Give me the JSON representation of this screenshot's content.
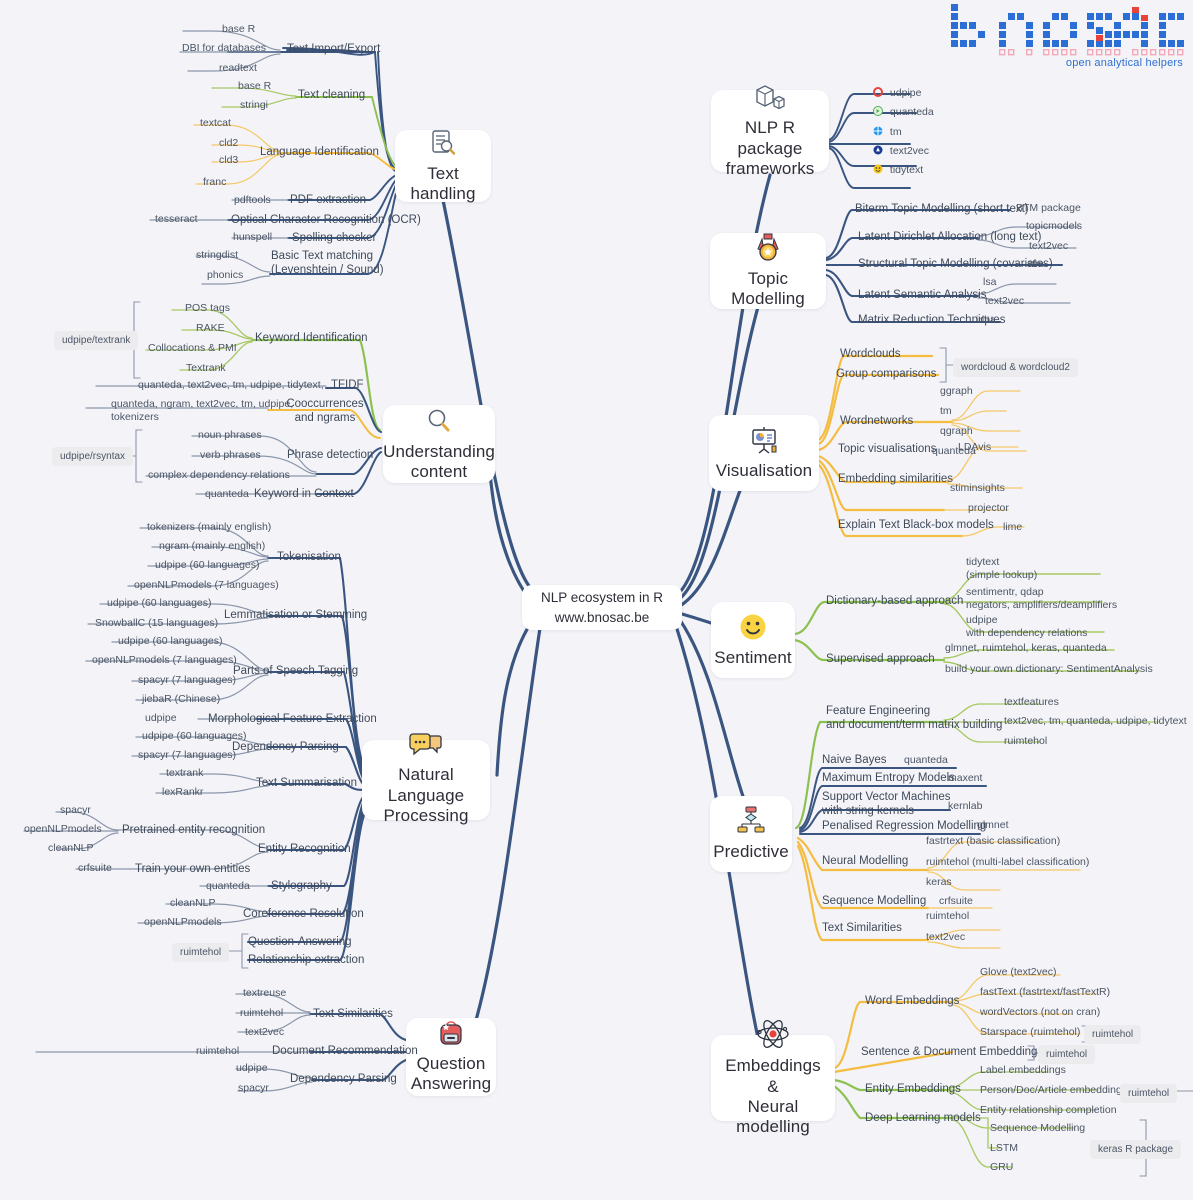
{
  "brand": {
    "name": "bnosac",
    "tagline": "open analytical helpers",
    "logo_colors": {
      "blue": "#2b6fd6",
      "pink": "#f3a8b8"
    }
  },
  "central": {
    "line1": "NLP ecosystem in R",
    "line2": "www.bnosac.be"
  },
  "palette": {
    "trunk": "#3a5580",
    "navy": "#3a5580",
    "green": "#8cc152",
    "yellow": "#f5bc42",
    "slate": "#8b96aa",
    "background": "#f4f4f8",
    "card": "#ffffff",
    "pill": "#ececef"
  },
  "branches": [
    {
      "id": "text-handling",
      "title": "Text handling",
      "icon": "document-magnifier-icon",
      "side": "left",
      "topics": [
        {
          "label": "Text Import/Export",
          "color": "navy",
          "leaves": [
            "base R",
            "DBI for databases",
            "readtext"
          ]
        },
        {
          "label": "Text cleaning",
          "color": "green",
          "leaves": [
            "base R",
            "stringi"
          ]
        },
        {
          "label": "Language Identification",
          "color": "yellow",
          "leaves": [
            "textcat",
            "cld2",
            "cld3",
            "franc"
          ]
        },
        {
          "label": "PDF extraction",
          "color": "navy",
          "leaves": [
            "pdftools"
          ]
        },
        {
          "label": "Optical Character Recognition (OCR)",
          "color": "navy",
          "leaves": [
            "tesseract"
          ]
        },
        {
          "label": "Spelling checker",
          "color": "navy",
          "leaves": [
            "hunspell"
          ]
        },
        {
          "label": "Basic Text matching (Levenshtein / Sound)",
          "color": "navy",
          "leaves": [
            "stringdist",
            "phonics"
          ]
        }
      ]
    },
    {
      "id": "understanding-content",
      "title": "Understanding content",
      "icon": "magnifying-glass-icon",
      "side": "left",
      "topics": [
        {
          "label": "Keyword Identification",
          "color": "green",
          "leaves": [
            "POS tags",
            "RAKE",
            "Collocations & PMI",
            "Textrank"
          ],
          "badge": "udpipe/textrank"
        },
        {
          "label": "TFIDF",
          "color": "navy",
          "leaves": [
            "quanteda, text2vec, tm, udpipe, tidytext, ..."
          ]
        },
        {
          "label": "Cooccurrences and ngrams",
          "color": "yellow",
          "leaves": [
            "quanteda, ngram, text2vec, tm, udpipe, tokenizers"
          ]
        },
        {
          "label": "Phrase detection",
          "color": "navy",
          "leaves": [
            "noun phrases",
            "verb phrases",
            "complex dependency relations"
          ],
          "badge": "udpipe/rsyntax"
        },
        {
          "label": "Keyword in Context",
          "color": "navy",
          "leaves": [
            "quanteda"
          ]
        }
      ]
    },
    {
      "id": "natural-language-processing",
      "title": "Natural Language Processing",
      "icon": "speech-bubbles-icon",
      "side": "left",
      "topics": [
        {
          "label": "Tokenisation",
          "color": "navy",
          "leaves": [
            "tokenizers (mainly english)",
            "ngram (mainly english)",
            "udpipe (60 languages)",
            "openNLPmodels (7 languages)"
          ]
        },
        {
          "label": "Lemmatisation or Stemming",
          "color": "navy",
          "leaves": [
            "udpipe (60 languages)",
            "SnowballC (15 languages)"
          ]
        },
        {
          "label": "Parts of Speech Tagging",
          "color": "navy",
          "leaves": [
            "udpipe (60 languages)",
            "openNLPmodels (7 languages)",
            "spacyr (7 languages)",
            "jiebaR (Chinese)"
          ]
        },
        {
          "label": "Morphological Feature Extraction",
          "color": "navy",
          "leaves": [
            "udpipe"
          ]
        },
        {
          "label": "Dependency Parsing",
          "color": "navy",
          "leaves": [
            "udpipe (60 languages)",
            "spacyr (7 languages)"
          ]
        },
        {
          "label": "Text Summarisation",
          "color": "navy",
          "leaves": [
            "textrank",
            "lexRankr"
          ]
        },
        {
          "label": "Entity Recognition",
          "color": "navy",
          "leaves": [
            "Pretrained entity recognition",
            "Train your own entities"
          ],
          "sub": [
            "spacyr",
            "openNLPmodels",
            "cleanNLP",
            "crfsuite"
          ]
        },
        {
          "label": "Stylography",
          "color": "navy",
          "leaves": [
            "quanteda"
          ]
        },
        {
          "label": "Coreference Resolution",
          "color": "navy",
          "leaves": [
            "cleanNLP",
            "openNLPmodels"
          ]
        },
        {
          "label": "Question-Answering",
          "color": "navy",
          "leaves": [],
          "badge": "ruimtehol"
        },
        {
          "label": "Relationship extraction",
          "color": "navy",
          "leaves": []
        }
      ]
    },
    {
      "id": "question-answering",
      "title": "Question Answering",
      "icon": "backpack-icon",
      "side": "left",
      "topics": [
        {
          "label": "Text Similarities",
          "color": "navy",
          "leaves": [
            "textreuse",
            "ruimtehol",
            "text2vec"
          ]
        },
        {
          "label": "Document Recommendation",
          "color": "navy",
          "leaves": [
            "ruimtehol"
          ]
        },
        {
          "label": "Dependency Parsing",
          "color": "navy",
          "leaves": [
            "udpipe",
            "spacyr"
          ]
        }
      ]
    },
    {
      "id": "nlp-r-package-frameworks",
      "title": "NLP R package frameworks",
      "icon": "boxes-icon",
      "side": "right",
      "topics": [
        {
          "label": "udpipe",
          "color": "navy",
          "icon": "package-icon-red",
          "icon_color": "#e8433a"
        },
        {
          "label": "quanteda",
          "color": "navy",
          "icon": "package-icon-green",
          "icon_color": "#4cae50"
        },
        {
          "label": "tm",
          "color": "navy",
          "icon": "package-icon-blue",
          "icon_color": "#2196f3"
        },
        {
          "label": "text2vec",
          "color": "navy",
          "icon": "package-icon-darkblue",
          "icon_color": "#1b3a93"
        },
        {
          "label": "tidytext",
          "color": "navy",
          "icon": "package-icon-yellow",
          "icon_color": "#f5c518"
        }
      ]
    },
    {
      "id": "topic-modelling",
      "title": "Topic Modelling",
      "icon": "medal-icon",
      "side": "right",
      "topics": [
        {
          "label": "Biterm Topic Modelling (short text)",
          "color": "navy",
          "leaves": [
            "BTM package"
          ]
        },
        {
          "label": "Latent Dirichlet Allocation (long text)",
          "color": "navy",
          "leaves": [
            "topicmodels",
            "text2vec"
          ]
        },
        {
          "label": "Structural Topic Modelling (covariates)",
          "color": "navy",
          "leaves": [
            "stm"
          ]
        },
        {
          "label": "Latent Semantic Analysis",
          "color": "navy",
          "leaves": [
            "lsa",
            "text2vec"
          ]
        },
        {
          "label": "Matrix Reduction Techniques",
          "color": "navy",
          "leaves": [
            "irlba"
          ]
        }
      ]
    },
    {
      "id": "visualisation",
      "title": "Visualisation",
      "icon": "presentation-chart-icon",
      "side": "right",
      "topics": [
        {
          "label": "Wordclouds",
          "color": "yellow",
          "leaves": [],
          "badge": "wordcloud & wordcloud2"
        },
        {
          "label": "Group comparisons",
          "color": "yellow",
          "leaves": []
        },
        {
          "label": "Wordnetworks",
          "color": "yellow",
          "leaves": [
            "ggraph",
            "tm",
            "qgraph",
            "quanteda"
          ]
        },
        {
          "label": "Topic visualisations",
          "color": "yellow",
          "leaves": [
            "LDAvis",
            "stiminsights"
          ]
        },
        {
          "label": "Embedding similarities",
          "color": "yellow",
          "leaves": [
            "projector"
          ]
        },
        {
          "label": "Explain Text Black-box models",
          "color": "yellow",
          "leaves": [
            "lime"
          ]
        }
      ]
    },
    {
      "id": "sentiment",
      "title": "Sentiment",
      "icon": "smiley-face-icon",
      "side": "right",
      "topics": [
        {
          "label": "Dictionary-based approach",
          "color": "green",
          "leaves": [
            "tidytext (simple lookup)",
            "sentimentr, qdap negators, amplifiers/deamplifiers",
            "udpipe with dependency relations"
          ]
        },
        {
          "label": "Supervised approach",
          "color": "green",
          "leaves": [
            "glmnet, ruimtehol, keras, quanteda",
            "build your own dictionary: SentimentAnalysis"
          ]
        }
      ]
    },
    {
      "id": "predictive",
      "title": "Predictive",
      "icon": "flowchart-icon",
      "side": "right",
      "topics": [
        {
          "label": "Feature Engineering and document/term matrix building",
          "color": "green",
          "leaves": [
            "textfeatures",
            "text2vec, tm, quanteda, udpipe, tidytext",
            "ruimtehol"
          ]
        },
        {
          "label": "Naive Bayes",
          "color": "navy",
          "leaves": [
            "quanteda"
          ]
        },
        {
          "label": "Maximum Entropy Models",
          "color": "navy",
          "leaves": [
            "maxent"
          ]
        },
        {
          "label": "Support Vector Machines with string kernels",
          "color": "navy",
          "leaves": [
            "kernlab"
          ]
        },
        {
          "label": "Penalised Regression Modelling",
          "color": "navy",
          "leaves": [
            "glmnet"
          ]
        },
        {
          "label": "Neural Modelling",
          "color": "yellow",
          "leaves": [
            "fastrtext (basic classification)",
            "ruimtehol (multi-label classification)",
            "keras"
          ]
        },
        {
          "label": "Sequence Modelling",
          "color": "yellow",
          "leaves": [
            "crfsuite"
          ]
        },
        {
          "label": "Text Similarities",
          "color": "yellow",
          "leaves": [
            "ruimtehol",
            "text2vec"
          ]
        }
      ]
    },
    {
      "id": "embeddings-neural-modelling",
      "title": "Embeddings & Neural modelling",
      "icon": "atom-icon",
      "side": "right",
      "topics": [
        {
          "label": "Word Embeddings",
          "color": "yellow",
          "leaves": [
            "Glove (text2vec)",
            "fastText (fastrtext/fastTextR)",
            "wordVectors (not on cran)",
            "Starspace (ruimtehol)"
          ],
          "badge": "ruimtehol"
        },
        {
          "label": "Sentence & Document Embeddings",
          "color": "yellow",
          "leaves": [],
          "badge": "ruimtehol"
        },
        {
          "label": "Entity Embeddings",
          "color": "green",
          "leaves": [
            "Label embeddings",
            "Person/Doc/Article embeddings",
            "Entity relationship completion"
          ],
          "badge": "ruimtehol"
        },
        {
          "label": "Deep Learning models",
          "color": "green",
          "leaves": [
            "Sequence Modelling",
            "LSTM",
            "GRU"
          ],
          "badge": "keras R package"
        }
      ]
    }
  ],
  "labels": {
    "text_handling": {
      "title": "Text handling",
      "t1": "Text Import/Export",
      "t1a": "base R",
      "t1b": "DBI for databases",
      "t1c": "readtext",
      "t2": "Text cleaning",
      "t2a": "base R",
      "t2b": "stringi",
      "t3": "Language Identification",
      "t3a": "textcat",
      "t3b": "cld2",
      "t3c": "cld3",
      "t3d": "franc",
      "t4": "PDF extraction",
      "t4a": "pdftools",
      "t5": "Optical Character Recognition (OCR)",
      "t5a": "tesseract",
      "t6": "Spelling checker",
      "t6a": "hunspell",
      "t7l1": "Basic Text matching",
      "t7l2": "(Levenshtein / Sound)",
      "t7a": "stringdist",
      "t7b": "phonics"
    },
    "understanding": {
      "title1": "Understanding",
      "title2": "content",
      "k": "Keyword Identification",
      "k1": "POS tags",
      "k2": "RAKE",
      "k3": "Collocations & PMI",
      "k4": "Textrank",
      "kbadge": "udpipe/textrank",
      "tfidf": "TFIDF",
      "tfidf_pkgs": "quanteda, text2vec, tm, udpipe, tidytext, ...",
      "cooc1": "Cooccurrences",
      "cooc2": "and ngrams",
      "cooc_p1": "quanteda, ngram, text2vec, tm, udpipe,",
      "cooc_p2": "tokenizers",
      "phrase": "Phrase detection",
      "p1": "noun phrases",
      "p2": "verb phrases",
      "p3": "complex dependency relations",
      "pbadge": "udpipe/rsyntax",
      "kwic": "Keyword in Context",
      "kwic1": "quanteda"
    },
    "nlp": {
      "title1": "Natural Language",
      "title2": "Processing",
      "tok": "Tokenisation",
      "tok1": "tokenizers (mainly english)",
      "tok2": "ngram (mainly english)",
      "tok3": "udpipe (60 languages)",
      "tok4": "openNLPmodels (7 languages)",
      "lem": "Lemmatisation or Stemming",
      "lem1": "udpipe (60 languages)",
      "lem2": "SnowballC (15 languages)",
      "pos": "Parts of Speech Tagging",
      "pos1": "udpipe (60 languages)",
      "pos2": "openNLPmodels (7 languages)",
      "pos3": "spacyr (7 languages)",
      "pos4": "jiebaR (Chinese)",
      "morph": "Morphological Feature Extraction",
      "morph1": "udpipe",
      "dep": "Dependency Parsing",
      "dep1": "udpipe (60 languages)",
      "dep2": "spacyr (7 languages)",
      "sum": "Text Summarisation",
      "sum1": "textrank",
      "sum2": "lexRankr",
      "ent": "Entity Recognition",
      "ent_pre": "Pretrained entity recognition",
      "ent_train": "Train your own entities",
      "ent1": "spacyr",
      "ent2": "openNLPmodels",
      "ent3": "cleanNLP",
      "ent4": "crfsuite",
      "sty": "Stylography",
      "sty1": "quanteda",
      "coref": "Coreference Resolution",
      "coref1": "cleanNLP",
      "coref2": "openNLPmodels",
      "qa": "Question-Answering",
      "rel": "Relationship extraction",
      "qabadge": "ruimtehol"
    },
    "qa": {
      "title1": "Question",
      "title2": "Answering",
      "sim": "Text Similarities",
      "sim1": "textreuse",
      "sim2": "ruimtehol",
      "sim3": "text2vec",
      "rec": "Document Recommendation",
      "rec1": "ruimtehol",
      "dep": "Dependency Parsing",
      "dep1": "udpipe",
      "dep2": "spacyr"
    },
    "frameworks": {
      "title1": "NLP R package",
      "title2": "frameworks",
      "p1": "udpipe",
      "p2": "quanteda",
      "p3": "tm",
      "p4": "text2vec",
      "p5": "tidytext"
    },
    "topic": {
      "title": "Topic Modelling",
      "a": "Biterm Topic Modelling (short text)",
      "a1": "BTM package",
      "b": "Latent Dirichlet Allocation (long text)",
      "b1": "topicmodels",
      "b2": "text2vec",
      "c": "Structural Topic Modelling (covariates)",
      "c1": "stm",
      "d": "Latent Semantic Analysis",
      "d1": "lsa",
      "d2": "text2vec",
      "e": "Matrix Reduction Techniques",
      "e1": "irlba"
    },
    "visual": {
      "title": "Visualisation",
      "a": "Wordclouds",
      "b": "Group comparisons",
      "ab_badge": "wordcloud & wordcloud2",
      "c": "Wordnetworks",
      "c1": "ggraph",
      "c2": "tm",
      "c3": "qgraph",
      "c4": "quanteda",
      "d": "Topic visualisations",
      "d1": "LDAvis",
      "d2": "stiminsights",
      "e": "Embedding similarities",
      "e1": "projector",
      "f": "Explain Text Black-box models",
      "f1": "lime"
    },
    "sentiment": {
      "title": "Sentiment",
      "dict": "Dictionary-based approach",
      "d1a": "tidytext",
      "d1b": "(simple lookup)",
      "d2a": "sentimentr, qdap",
      "d2b": "negators, amplifiers/deamplifiers",
      "d3a": "udpipe",
      "d3b": "with dependency relations",
      "sup": "Supervised approach",
      "s1": "glmnet, ruimtehol, keras, quanteda",
      "s2": "build your own dictionary: SentimentAnalysis"
    },
    "predictive": {
      "title": "Predictive",
      "fe1": "Feature Engineering",
      "fe2": "and document/term matrix building",
      "fe_a": "textfeatures",
      "fe_b": "text2vec, tm, quanteda, udpipe, tidytext",
      "fe_c": "ruimtehol",
      "nb": "Naive Bayes",
      "nb1": "quanteda",
      "me": "Maximum Entropy Models",
      "me1": "maxent",
      "svm1": "Support Vector Machines",
      "svm2": "with string kernels",
      "svm_p": "kernlab",
      "pr": "Penalised Regression Modelling",
      "pr1": "glmnet",
      "nm": "Neural Modelling",
      "nm1": "fastrtext (basic classification)",
      "nm2": "ruimtehol (multi-label classification)",
      "nm3": "keras",
      "sq": "Sequence Modelling",
      "sq1": "crfsuite",
      "ts": "Text Similarities",
      "ts1": "ruimtehol",
      "ts2": "text2vec"
    },
    "embeddings": {
      "title1": "Embeddings &",
      "title2": "Neural modelling",
      "we": "Word Embeddings",
      "we1": "Glove (text2vec)",
      "we2": "fastText (fastrtext/fastTextR)",
      "we3": "wordVectors (not on cran)",
      "we4": "Starspace (ruimtehol)",
      "we_badge": "ruimtehol",
      "sd": "Sentence & Document Embeddings",
      "sd_badge": "ruimtehol",
      "ee": "Entity Embeddings",
      "ee1": "Label embeddings",
      "ee2": "Person/Doc/Article embeddings",
      "ee3": "Entity relationship completion",
      "ee_badge": "ruimtehol",
      "dl": "Deep Learning models",
      "dl1": "Sequence Modelling",
      "dl2": "LSTM",
      "dl3": "GRU",
      "dl_badge": "keras R package"
    }
  }
}
